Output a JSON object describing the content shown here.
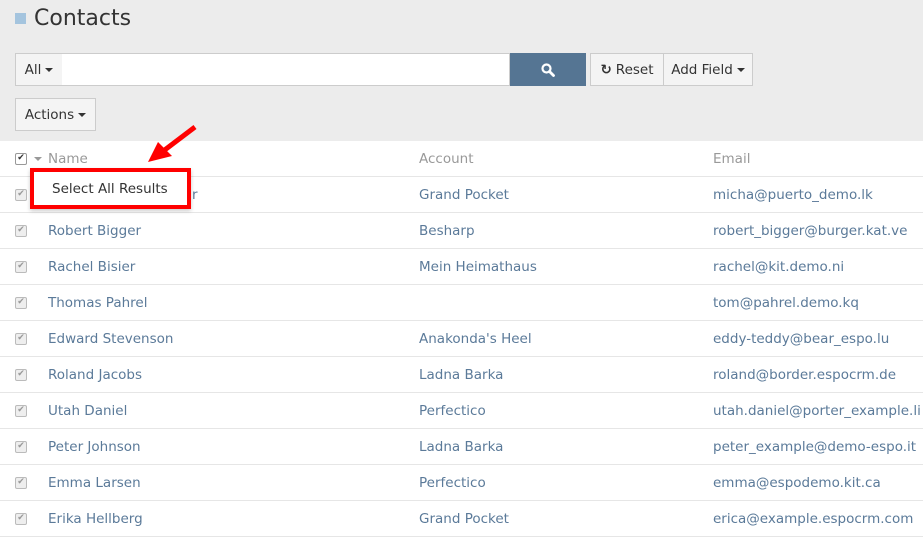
{
  "header": {
    "title": "Contacts"
  },
  "search": {
    "filter_label": "All",
    "value": "",
    "placeholder": "",
    "search_icon": "search-icon",
    "reset_label": "Reset",
    "add_field_label": "Add Field"
  },
  "actions_label": "Actions",
  "table": {
    "columns": [
      "Name",
      "Account",
      "Email"
    ],
    "rows": [
      {
        "name": "r",
        "account": "Grand Pocket",
        "email": "micha@puerto_demo.lk"
      },
      {
        "name": "Robert Bigger",
        "account": "Besharp",
        "email": "robert_bigger@burger.kat.ve"
      },
      {
        "name": "Rachel Bisier",
        "account": "Mein Heimathaus",
        "email": "rachel@kit.demo.ni"
      },
      {
        "name": "Thomas Pahrel",
        "account": "",
        "email": "tom@pahrel.demo.kq"
      },
      {
        "name": "Edward Stevenson",
        "account": "Anakonda's Heel",
        "email": "eddy-teddy@bear_espo.lu"
      },
      {
        "name": "Roland Jacobs",
        "account": "Ladna Barka",
        "email": "roland@border.espocrm.de"
      },
      {
        "name": "Utah Daniel",
        "account": "Perfectico",
        "email": "utah.daniel@porter_example.li"
      },
      {
        "name": "Peter Johnson",
        "account": "Ladna Barka",
        "email": "peter_example@demo-espo.it"
      },
      {
        "name": "Emma Larsen",
        "account": "Perfectico",
        "email": "emma@espodemo.kit.ca"
      },
      {
        "name": "Erika Hellberg",
        "account": "Grand Pocket",
        "email": "erica@example.espocrm.com"
      }
    ]
  },
  "dropdown": {
    "select_all_label": "Select All Results"
  },
  "colors": {
    "accent": "#557593",
    "highlight": "#ff0000",
    "link": "#5b7a99"
  }
}
